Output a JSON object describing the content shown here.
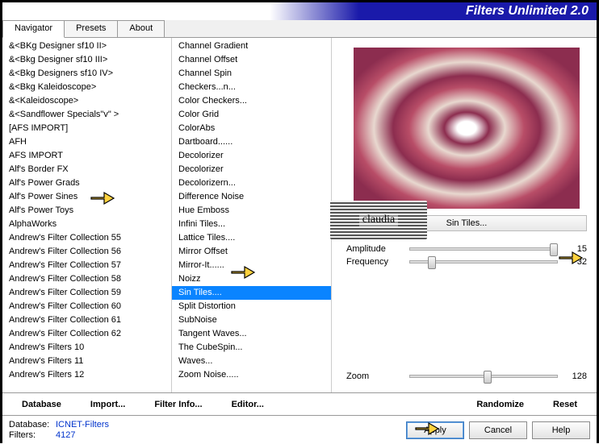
{
  "title": "Filters Unlimited 2.0",
  "tabs": [
    {
      "label": "Navigator",
      "active": true
    },
    {
      "label": "Presets",
      "active": false
    },
    {
      "label": "About",
      "active": false
    }
  ],
  "categories": [
    "&<BKg Designer sf10 II>",
    "&<Bkg Designer sf10 III>",
    "&<Bkg Designers sf10 IV>",
    "&<Bkg Kaleidoscope>",
    "&<Kaleidoscope>",
    "&<Sandflower Specials\"v\" >",
    "[AFS IMPORT]",
    "AFH",
    "AFS IMPORT",
    "Alf's Border FX",
    "Alf's Power Grads",
    "Alf's Power Sines",
    "Alf's Power Toys",
    "AlphaWorks",
    "Andrew's Filter Collection 55",
    "Andrew's Filter Collection 56",
    "Andrew's Filter Collection 57",
    "Andrew's Filter Collection 58",
    "Andrew's Filter Collection 59",
    "Andrew's Filter Collection 60",
    "Andrew's Filter Collection 61",
    "Andrew's Filter Collection 62",
    "Andrew's Filters 10",
    "Andrew's Filters 11",
    "Andrew's Filters 12"
  ],
  "filters": [
    "Channel Gradient",
    "Channel Offset",
    "Channel Spin",
    "Checkers...n...",
    "Color Checkers...",
    "Color Grid",
    "ColorAbs",
    "Dartboard......",
    "Decolorizer",
    "Decolorizer",
    "Decolorizern...",
    "Difference Noise",
    "Hue Emboss",
    "Infini Tiles...",
    "Lattice Tiles....",
    "Mirror Offset",
    "Mirror-It......",
    "Noizz",
    "Sin Tiles....",
    "Split Distortion",
    "SubNoise",
    "Tangent Waves...",
    "The CubeSpin...",
    "Waves...",
    "Zoom Noise....."
  ],
  "filter_selected_index": 18,
  "subtitle": "Sin Tiles...",
  "sliders": [
    {
      "label": "Amplitude",
      "value": 15,
      "pos": 95
    },
    {
      "label": "Frequency",
      "value": 32,
      "pos": 12
    }
  ],
  "zoom": {
    "label": "Zoom",
    "value": 128,
    "pos": 50
  },
  "toolbar": {
    "database": "Database",
    "import": "Import...",
    "filter_info": "Filter Info...",
    "editor": "Editor...",
    "randomize": "Randomize",
    "reset": "Reset"
  },
  "footer": {
    "database_label": "Database:",
    "database_value": "ICNET-Filters",
    "filters_label": "Filters:",
    "filters_value": "4127",
    "apply": "Apply",
    "cancel": "Cancel",
    "help": "Help"
  },
  "watermark": "claudia"
}
